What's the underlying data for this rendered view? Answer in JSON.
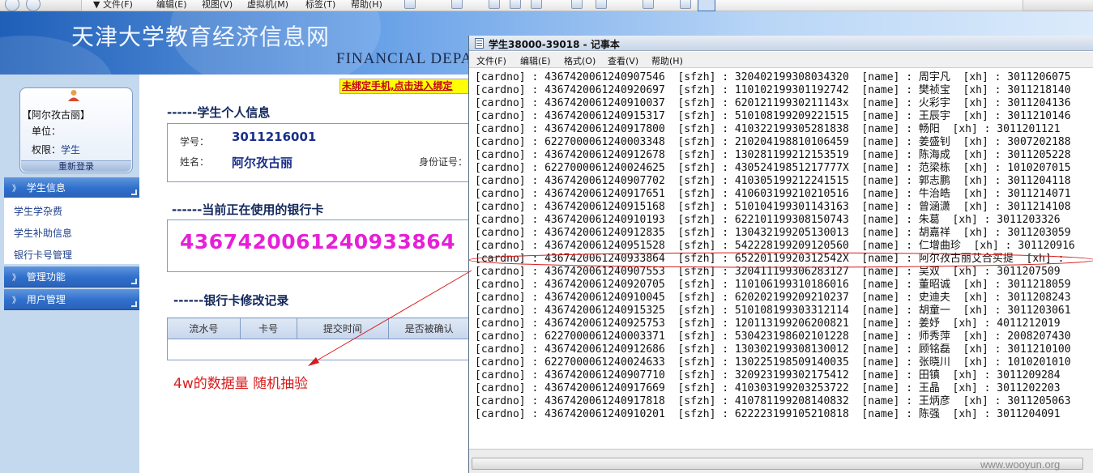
{
  "browser_toolbar": {
    "menu_items": [
      "文件(F)",
      "编辑(E)",
      "视图(V)",
      "虚拟机(M)",
      "标签(T)",
      "帮助(H)"
    ]
  },
  "site": {
    "title": "天津大学教育经济信息网",
    "subtitle": "FINANCIAL DEPA"
  },
  "user_card": {
    "name": "【阿尔孜古丽】",
    "unit_label": "单位：",
    "role_label": "权限：",
    "role_value": "学生",
    "relogin_label": "重新登录"
  },
  "sidebar": {
    "sections": [
      {
        "label": "学生信息",
        "items": [
          "学生学杂费",
          "学生补助信息",
          "银行卡号管理"
        ]
      },
      {
        "label": "管理功能"
      },
      {
        "label": "用户管理"
      }
    ],
    "chevron_glyph": "》"
  },
  "notice": {
    "text": "未绑定手机,点击进入绑定"
  },
  "student_info": {
    "section_title": "------学生个人信息",
    "id_label": "学号：",
    "id_value": "3011216001",
    "name_label": "姓名：",
    "name_value": "阿尔孜古丽",
    "idcard_label": "身份证号："
  },
  "bank_card": {
    "section_title": "------当前正在使用的银行卡",
    "card_number": "4367420061240933864"
  },
  "history": {
    "section_title": "------银行卡修改记录",
    "columns": [
      "流水号",
      "卡号",
      "提交时间",
      "是否被确认"
    ]
  },
  "annotation": {
    "text": "4w的数据量   随机抽验",
    "color": "#d81b1b"
  },
  "notepad": {
    "title": "学生38000-39018 - 记事本",
    "menus": [
      "文件(F)",
      "编辑(E)",
      "格式(O)",
      "查看(V)",
      "帮助(H)"
    ],
    "lines": [
      "[cardno] : 4367420061240907546  [sfzh] : 320402199308034320  [name] : 周宇凡  [xh] : 3011206075",
      "[cardno] : 4367420061240920697  [sfzh] : 110102199301192742  [name] : 樊祯宝  [xh] : 3011218140",
      "[cardno] : 4367420061240910037  [sfzh] : 62012119930211143x  [name] : 火彩宇  [xh] : 3011204136",
      "[cardno] : 4367420061240915317  [sfzh] : 510108199209221515  [name] : 王辰宇  [xh] : 3011210146",
      "[cardno] : 4367420061240917800  [sfzh] : 410322199305281838  [name] : 畅阳  [xh] : 3011201121",
      "[cardno] : 6227000061240003348  [sfzh] : 210204198810106459  [name] : 姜盛钊  [xh] : 3007202188",
      "[cardno] : 4367420061240912678  [sfzh] : 130281199212153519  [name] : 陈海成  [xh] : 3011205228",
      "[cardno] : 6227000061240024625  [sfzh] : 43052419851217777X  [name] : 范梁栋  [xh] : 1010207015",
      "[cardno] : 4367420061240907702  [sfzh] : 410305199212241515  [name] : 郭志鹏  [xh] : 3011204118",
      "[cardno] : 4367420061240917651  [sfzh] : 410603199210210516  [name] : 牛治皓  [xh] : 3011214071",
      "[cardno] : 4367420061240915168  [sfzh] : 510104199301143163  [name] : 曾涵潇  [xh] : 3011214108",
      "[cardno] : 4367420061240910193  [sfzh] : 622101199308150743  [name] : 朱葛  [xh] : 3011203326",
      "[cardno] : 4367420061240912835  [sfzh] : 130432199205130013  [name] : 胡嘉祥  [xh] : 3011203059",
      "[cardno] : 4367420061240951528  [sfzh] : 542228199209120560  [name] : 仁增曲珍  [xh] : 301120916",
      "[cardno] : 4367420061240933864  [sfzh] : 65220119920312542X  [name] : 阿尔孜古丽艾合买提  [xh] :",
      "[cardno] : 4367420061240907553  [sfzh] : 320411199306283127  [name] : 吴双  [xh] : 3011207509",
      "[cardno] : 4367420061240920705  [sfzh] : 110106199310186016  [name] : 董昭诚  [xh] : 3011218059",
      "[cardno] : 4367420061240910045  [sfzh] : 620202199209210237  [name] : 史迪夫  [xh] : 3011208243",
      "[cardno] : 4367420061240915325  [sfzh] : 510108199303312114  [name] : 胡童一  [xh] : 3011203061",
      "[cardno] : 4367420061240925753  [sfzh] : 120113199206200821  [name] : 姜妤  [xh] : 4011212019",
      "[cardno] : 6227000061240003371  [sfzh] : 530423198602101228  [name] : 师秀萍  [xh] : 2008207430",
      "[cardno] : 4367420061240912686  [sfzh] : 130302199308130012  [name] : 顾铭磊  [xh] : 3011210100",
      "[cardno] : 6227000061240024633  [sfzh] : 130225198509140035  [name] : 张晓川  [xh] : 1010201010",
      "[cardno] : 4367420061240907710  [sfzh] : 320923199302175412  [name] : 田镇  [xh] : 3011209284",
      "[cardno] : 4367420061240917669  [sfzh] : 410303199203253722  [name] : 王晶  [xh] : 3011202203",
      "[cardno] : 4367420061240917818  [sfzh] : 410781199208140832  [name] : 王炳彦  [xh] : 3011205063",
      "[cardno] : 4367420061240910201  [sfzh] : 622223199105210818  [name] : 陈强  [xh] : 3011204091"
    ],
    "highlighted_line_index": 14
  },
  "watermark": "www.wooyun.org",
  "colors": {
    "header_blue": "#2f6fcb",
    "card_magenta": "#e61fd8",
    "annotation_red": "#d81b1b",
    "notice_yellow": "#ffff00"
  }
}
